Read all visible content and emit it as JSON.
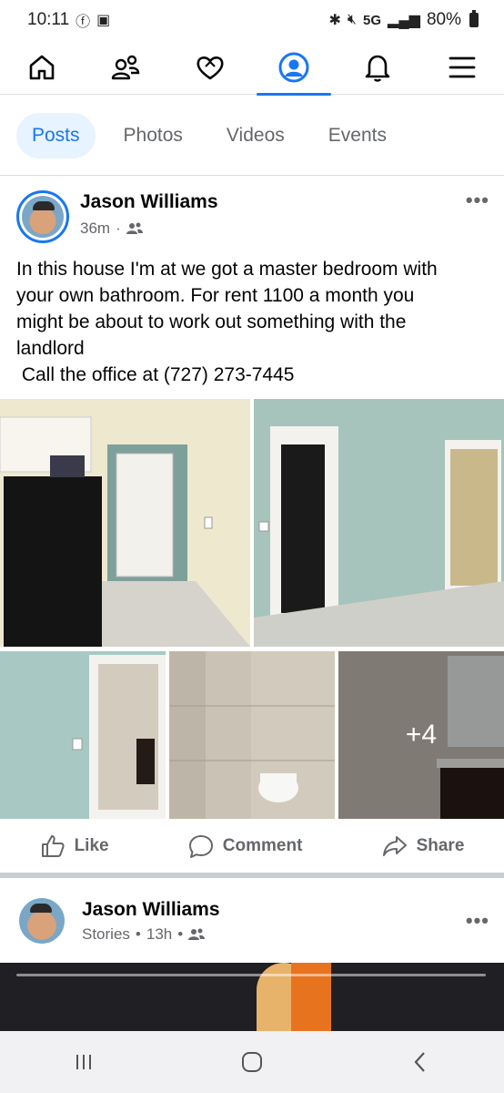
{
  "status_bar": {
    "time": "10:11",
    "network": "5G",
    "battery": "80%"
  },
  "nav": {
    "items": [
      "home",
      "friends",
      "dating",
      "profile",
      "notifications",
      "menu"
    ],
    "active": "profile"
  },
  "tabs": [
    {
      "label": "Posts",
      "active": true
    },
    {
      "label": "Photos",
      "active": false
    },
    {
      "label": "Videos",
      "active": false
    },
    {
      "label": "Events",
      "active": false
    }
  ],
  "post": {
    "author": "Jason Williams",
    "time": "36m",
    "privacy": "friends",
    "text_lines": [
      "In this house I'm at we got a master bedroom with",
      "your own bathroom. For rent 1100 a month you",
      "might be about to work out something with the",
      "landlord",
      " Call the office at (727) 273-7445"
    ],
    "more_photos": "+4",
    "actions": {
      "like": "Like",
      "comment": "Comment",
      "share": "Share"
    }
  },
  "post2": {
    "author": "Jason Williams",
    "source": "Stories",
    "time": "13h"
  },
  "colors": {
    "accent": "#1877f2",
    "muted": "#65676b",
    "divider": "#dadde1"
  }
}
